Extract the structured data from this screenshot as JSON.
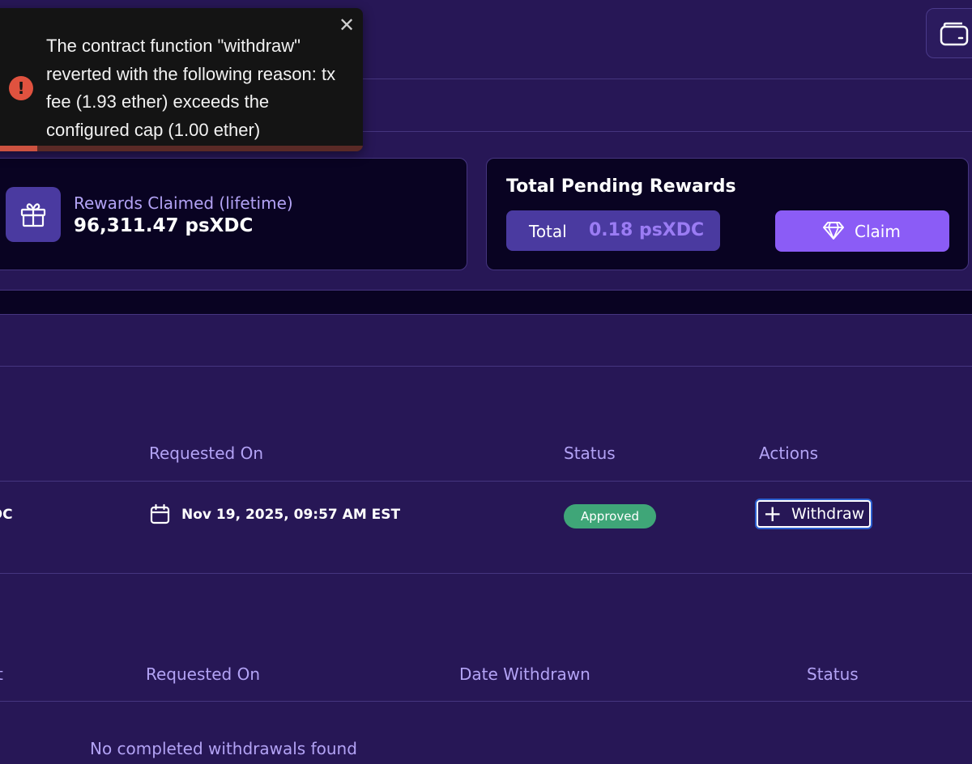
{
  "toast": {
    "message": "The contract function \"withdraw\" reverted with the following reason: tx fee (1.93 ether) exceeds the configured cap (1.00 ether)",
    "icon": "exclamation-icon",
    "close_glyph": "✕",
    "progress_fraction": 0.14,
    "colors": {
      "background": "#141414",
      "icon": "#e0523f",
      "progress": "#cc5240"
    }
  },
  "header": {
    "wallet_icon": "wallet-icon"
  },
  "rewards_claimed": {
    "label": "Rewards Claimed (lifetime)",
    "value": "96,311.47 psXDC",
    "icon": "gift-icon"
  },
  "pending_rewards": {
    "title": "Total Pending Rewards",
    "total_label": "Total",
    "total_value": "0.18 psXDC",
    "claim_label": "Claim",
    "claim_icon": "diamond-icon"
  },
  "withdrawal_requests": {
    "headers": {
      "requested_on": "Requested On",
      "status": "Status",
      "actions": "Actions"
    },
    "rows": [
      {
        "amount_fragment": "DC",
        "requested_on": "Nov 19, 2025, 09:57 AM EST",
        "status": "Approved",
        "action_label": "Withdraw"
      }
    ]
  },
  "completed_withdrawals": {
    "headers": {
      "amount_fragment": "t",
      "requested_on": "Requested On",
      "date_withdrawn": "Date Withdrawn",
      "status": "Status"
    },
    "empty_message": "No completed withdrawals found"
  },
  "colors": {
    "page_bg": "#271756",
    "card_bg": "#090322",
    "accent": "#8b5cf6",
    "muted_text": "#b3a3f5",
    "approved": "#3fa678"
  }
}
